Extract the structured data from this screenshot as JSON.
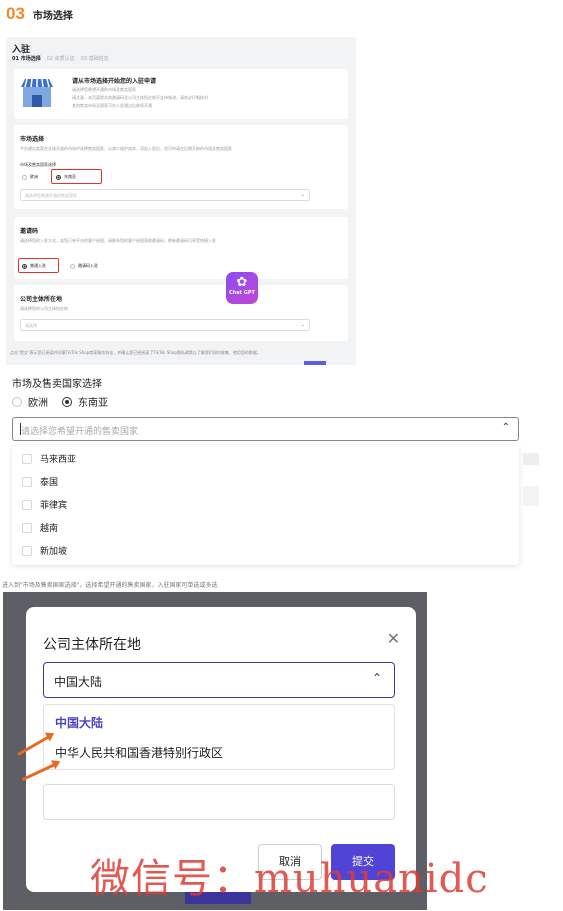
{
  "header": {
    "step_number": "03",
    "step_title": "市场选择"
  },
  "panel1": {
    "title": "入驻",
    "steps": [
      "01 市场选择",
      "02 资质认证",
      "03 基础信息"
    ],
    "intro_card": {
      "heading": "请从市场选择开始您的入驻申请",
      "lines": [
        "请选择您希望开通的市场及售卖国家",
        "请注意，本页面提交的邀请码及公司主体所在地不支持修改，请务必仔细核对",
        "其他售卖市场及国家可在入驻通过后继续开通"
      ]
    },
    "market_card": {
      "heading": "市场选择",
      "desc": "平台建议卖家在全球开放的市场中选择售卖国家，以减少维护成本，添加入驻后，也可申请在后期开辟的市场及售卖国家",
      "field_label": "市场及售卖国家选择",
      "options": [
        "欧洲",
        "东南亚"
      ],
      "selected": "东南亚",
      "select_placeholder": "请选择您希望开通的售卖国家"
    },
    "invite_card": {
      "heading": "邀请码",
      "desc": "请选择您的入驻方式，若您已有平台的客户经理，请联系您的客户经理获取邀请码，拥有邀请码可享受快捷入驻",
      "options": [
        "普通入驻",
        "邀请码入驻"
      ],
      "selected": "普通入驻"
    },
    "company_card": {
      "heading": "公司主体所在地",
      "desc": "请选择您的公司主体所在地",
      "select_placeholder": "请选择"
    },
    "chatgpt_badge": "Chat GPT",
    "footer_note": "点击\"提交\"表示您已阅读并同意TikTok Shop商家服务协议，并确认您已经阅读了TikTok Shop隐私政策以了解我们如何收集、使用您的数据。"
  },
  "panel2": {
    "field_label": "市场及售卖国家选择",
    "options": [
      "欧洲",
      "东南亚"
    ],
    "selected": "东南亚",
    "placeholder": "请选择您希望开通的售卖国家",
    "countries": [
      "马来西亚",
      "泰国",
      "菲律宾",
      "越南",
      "新加坡"
    ],
    "note": "进入到\"市场及售卖国家选择\"，选择希望开通的售卖国家，入驻国家可单选或多选"
  },
  "panel3": {
    "title": "公司主体所在地",
    "selected_value": "中国大陆",
    "options": [
      "中国大陆",
      "中华人民共和国香港特别行政区"
    ],
    "cancel_label": "取消",
    "submit_label": "提交"
  },
  "watermark": "微信号：muhuanidc",
  "colors": {
    "accent_orange": "#f08a2c",
    "primary_purple": "#4f44d6",
    "highlight_red": "#e0342a"
  },
  "icons": [
    "store-icon",
    "chevron-down-icon",
    "chevron-up-icon",
    "close-icon",
    "arrow-icon"
  ]
}
